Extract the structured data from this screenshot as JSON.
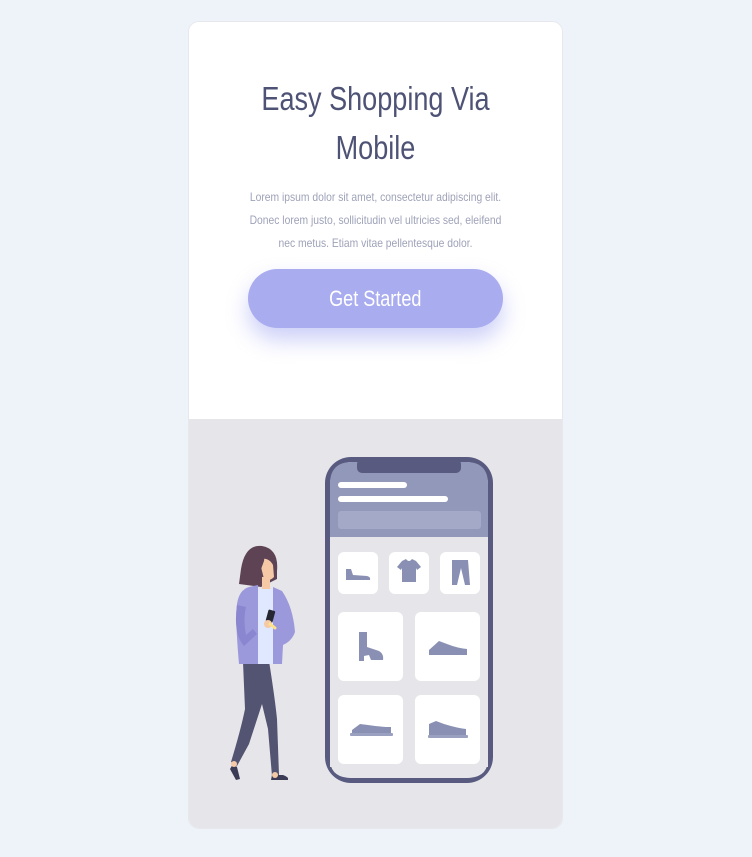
{
  "hero": {
    "title": "Easy Shopping Via Mobile",
    "description": "Lorem ipsum dolor sit amet, consectetur adipiscing elit. Donec lorem justo, sollicitudin vel ultricies sed, eleifend nec metus. Etiam vitae pellentesque dolor.",
    "cta_label": "Get Started"
  },
  "illustration": {
    "subject": "woman-with-phone-shopping",
    "products": [
      "flat-shoe-icon",
      "tshirt-icon",
      "pants-icon",
      "high-heel-boot-icon",
      "sneaker-icon",
      "sneaker-icon",
      "sneaker-icon"
    ]
  },
  "colors": {
    "page_bg": "#eef2f9",
    "card_bg": "#ffffff",
    "illustration_bg": "#e6e5ea",
    "title": "#4e5376",
    "body_text": "#9ea2b8",
    "button": "#a9acef",
    "phone_frame": "#585a80",
    "product_icon": "#8a90b3"
  }
}
